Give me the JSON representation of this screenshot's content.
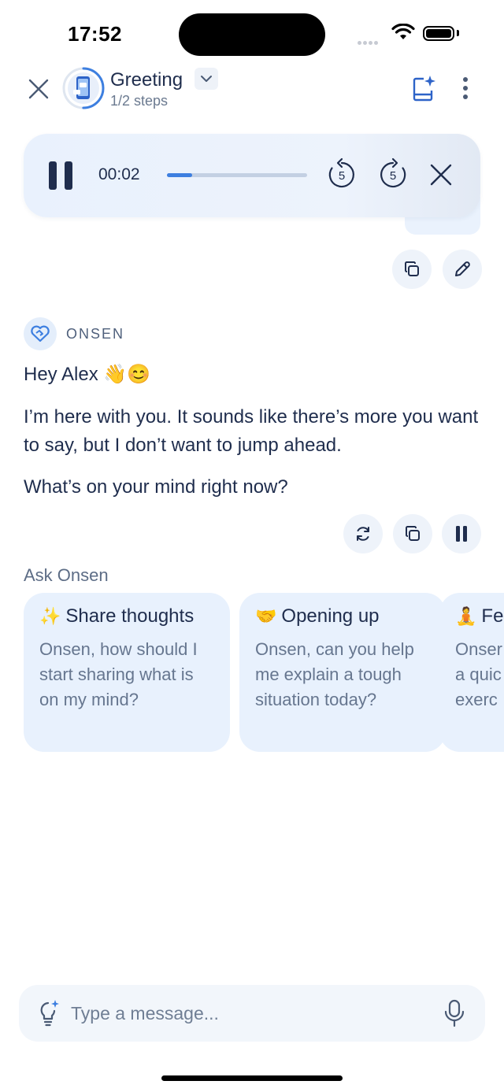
{
  "status_bar": {
    "time": "17:52"
  },
  "header": {
    "title": "Greeting",
    "subtitle": "1/2 steps",
    "progress_fraction": 0.5
  },
  "player": {
    "elapsed": "00:02",
    "progress_fraction": 0.18,
    "rewind_seconds": "5",
    "forward_seconds": "5"
  },
  "message": {
    "sender": "ONSEN",
    "greeting": "Hey Alex 👋😊",
    "paragraph": "I’m here with you. It sounds like there’s more you want to say, but I don’t want to jump ahead.",
    "question": "What’s on your mind right now?"
  },
  "ask_onsen": {
    "heading": "Ask Onsen",
    "cards": [
      {
        "emoji": "✨",
        "title": "Share thoughts",
        "body": "Onsen, how should I start sharing what is on my mind?"
      },
      {
        "emoji": "🤝",
        "title": "Opening up",
        "body": "Onsen, can you help me explain a tough situation today?"
      },
      {
        "emoji": "🧘",
        "title": "Fe",
        "body": "Onser a quic exerc"
      }
    ]
  },
  "composer": {
    "placeholder": "Type a message..."
  },
  "colors": {
    "accent": "#3d7fe0",
    "text": "#1f2d4d",
    "card_bg": "#e8f1fd"
  }
}
